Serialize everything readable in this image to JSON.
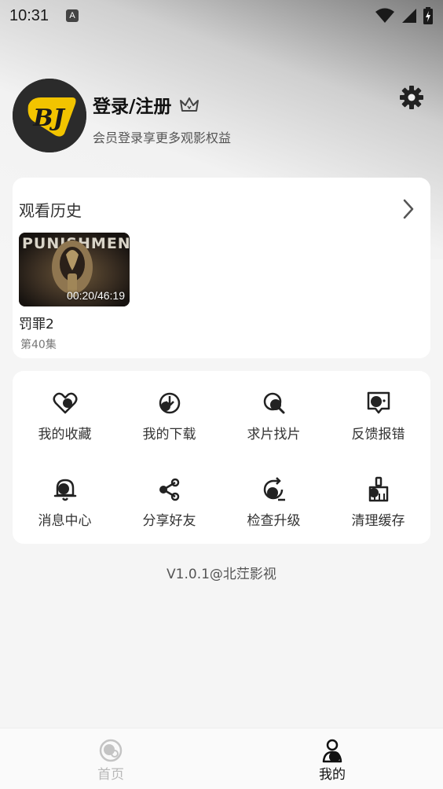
{
  "status_bar": {
    "time": "10:31",
    "indicator": "A",
    "icons": [
      "wifi-icon",
      "signal-icon",
      "battery-icon"
    ]
  },
  "profile": {
    "avatar_text": "BJ",
    "login_label": "登录/注册",
    "subtitle": "会员登录享更多观影权益",
    "icons": [
      "crown-icon",
      "gear-icon"
    ]
  },
  "history": {
    "title": "观看历史",
    "items": [
      {
        "poster_text": "PUNISHMENT",
        "progress": "00:20/46:19",
        "title": "罚罪2",
        "episode": "第40集"
      }
    ]
  },
  "menu": {
    "items": [
      {
        "label": "我的收藏",
        "icon": "heart-icon"
      },
      {
        "label": "我的下载",
        "icon": "download-icon"
      },
      {
        "label": "求片找片",
        "icon": "search-film-icon"
      },
      {
        "label": "反馈报错",
        "icon": "feedback-icon"
      },
      {
        "label": "消息中心",
        "icon": "bell-icon"
      },
      {
        "label": "分享好友",
        "icon": "share-icon"
      },
      {
        "label": "检查升级",
        "icon": "upgrade-icon"
      },
      {
        "label": "清理缓存",
        "icon": "broom-icon"
      }
    ]
  },
  "version": "V1.0.1@北茳影视",
  "tabbar": {
    "tabs": [
      {
        "label": "首页",
        "icon": "home-icon",
        "active": false
      },
      {
        "label": "我的",
        "icon": "mine-icon",
        "active": true
      }
    ]
  },
  "colors": {
    "background": "#f5f5f5",
    "card": "#ffffff",
    "logo_yellow": "#f2c400",
    "active_tab": "#111111",
    "inactive_tab": "#b8b8b8"
  }
}
